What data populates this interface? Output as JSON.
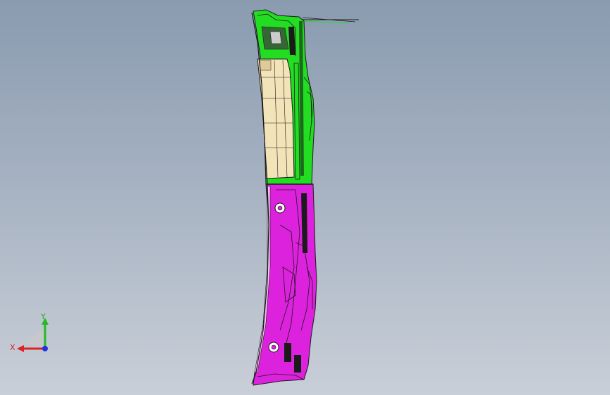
{
  "viewport": {
    "background_top": "#8a9bb0",
    "background_bottom": "#c9cfd8"
  },
  "model": {
    "upper_part_color": "#22dd22",
    "lower_part_color": "#dd22dd",
    "panel_color": "#f3e3b8",
    "edge_color": "#1a1a1a"
  },
  "triad": {
    "x_label": "X",
    "y_label": "Y",
    "x_color": "#dd2222",
    "y_color": "#22bb22",
    "z_color": "#2233dd"
  }
}
